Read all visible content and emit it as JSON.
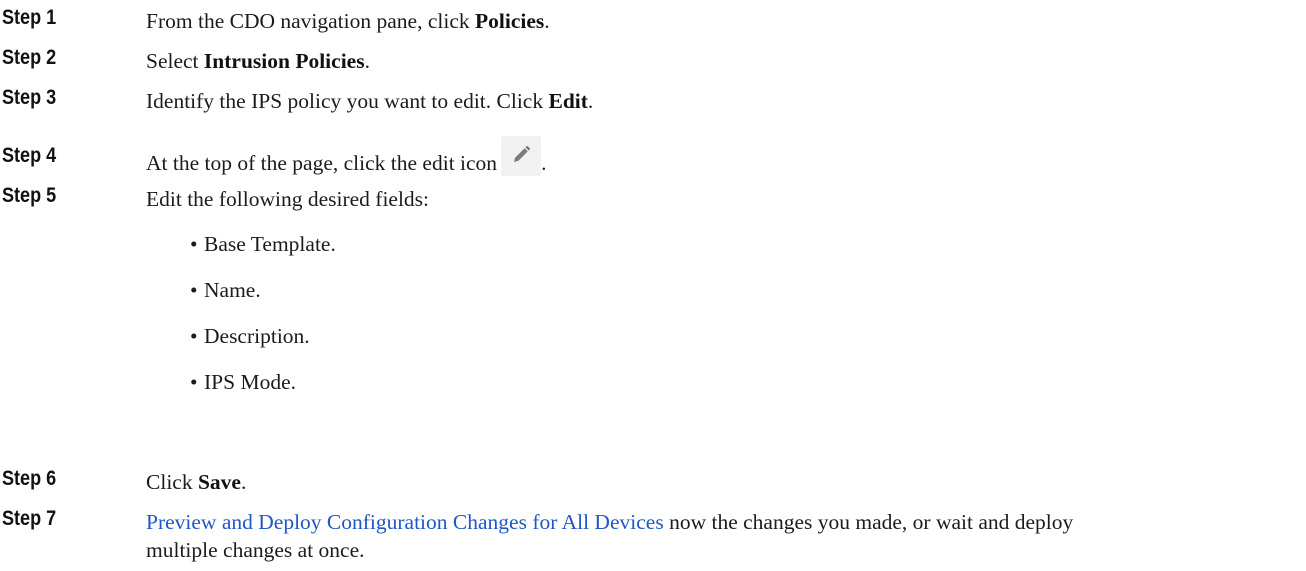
{
  "steps": [
    {
      "label": "Step 1",
      "pre": "From the CDO navigation pane, click ",
      "bold": "Policies",
      "post": "."
    },
    {
      "label": "Step 2",
      "pre": "Select ",
      "bold": "Intrusion Policies",
      "post": "."
    },
    {
      "label": "Step 3",
      "pre": "Identify the IPS policy you want to edit. Click ",
      "bold": "Edit",
      "post": "."
    },
    {
      "label": "Step 4",
      "pre": "At the top of the page, click the edit icon",
      "post": "."
    },
    {
      "label": "Step 5",
      "text": "Edit the following desired fields:"
    },
    {
      "label": "Step 6",
      "pre": "Click ",
      "bold": "Save",
      "post": "."
    },
    {
      "label": "Step 7",
      "link": "Preview and Deploy Configuration Changes for All Devices",
      "line1_rest": " now the changes you made, or wait and deploy",
      "line2": "multiple changes at once."
    }
  ],
  "fields": [
    "Base Template.",
    "Name.",
    "Description.",
    "IPS Mode."
  ],
  "icons": {
    "edit": "pencil-edit-icon",
    "bullet": "•"
  }
}
